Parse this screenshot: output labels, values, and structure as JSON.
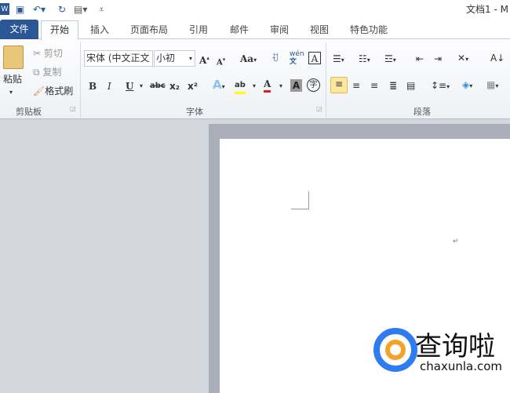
{
  "titlebar": {
    "title": "文档1 - M",
    "quick_access": [
      "word-logo",
      "save-icon",
      "undo-icon",
      "redo-icon",
      "print-preview-icon",
      "customize-icon"
    ]
  },
  "tabs": {
    "file": "文件",
    "items": [
      "开始",
      "插入",
      "页面布局",
      "引用",
      "邮件",
      "审阅",
      "视图",
      "特色功能"
    ],
    "active": "开始"
  },
  "clipboard": {
    "paste": "粘贴",
    "cut": "剪切",
    "copy": "复制",
    "format_painter": "格式刷",
    "label": "剪贴板"
  },
  "font": {
    "font_name": "宋体 (中文正文",
    "font_size": "小初",
    "label": "字体",
    "change_case": "Aa",
    "bold": "B",
    "italic": "I",
    "underline": "U",
    "strike": "abc",
    "sub": "x₂",
    "sup": "x²",
    "wen": "wén\n文",
    "char_border": "A",
    "highlight": "ab",
    "font_color": "A",
    "char_shading": "A",
    "enclose": "字"
  },
  "paragraph": {
    "label": "段落"
  },
  "colors": {
    "file_tab": "#2b5797",
    "font_color": "#e02020",
    "highlight": "#ffff00",
    "selected": "#fde8a0"
  },
  "watermark": {
    "brand": "查询啦",
    "url": "chaxunla.com"
  }
}
